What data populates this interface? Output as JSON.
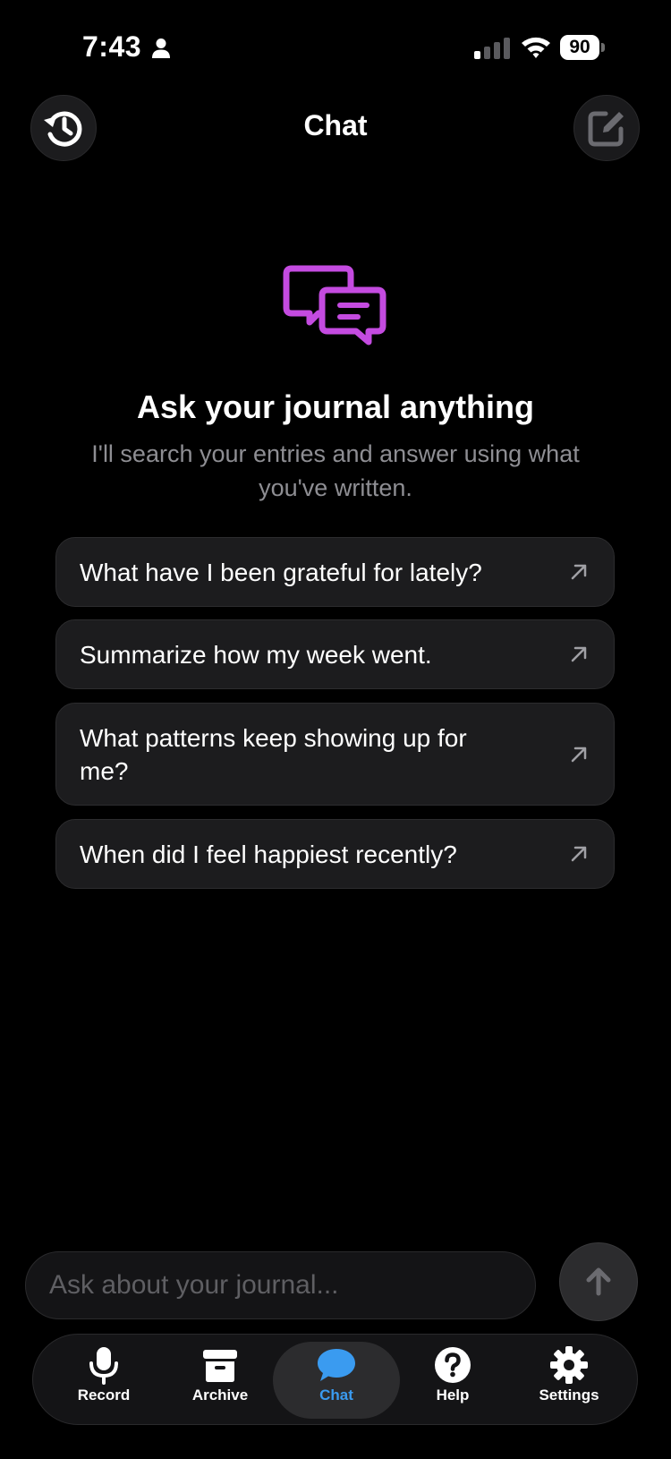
{
  "status_bar": {
    "time": "7:43",
    "battery": "90",
    "icons": [
      "person-icon",
      "cellular-signal-icon",
      "wifi-icon",
      "battery-icon"
    ]
  },
  "header": {
    "title": "Chat",
    "left_button_icon": "history-icon",
    "right_button_icon": "compose-icon"
  },
  "hero": {
    "icon": "chat-bubbles-icon",
    "title": "Ask your journal anything",
    "subtitle": "I'll search your entries and answer using what you've written."
  },
  "suggestions": [
    {
      "label": "What have I been grateful for lately?"
    },
    {
      "label": "Summarize how my week went."
    },
    {
      "label": "What patterns keep showing up for me?"
    },
    {
      "label": "When did I feel happiest recently?"
    }
  ],
  "input": {
    "placeholder": "Ask about your journal...",
    "value": ""
  },
  "tabs": [
    {
      "label": "Record",
      "icon": "microphone-icon",
      "active": false
    },
    {
      "label": "Archive",
      "icon": "archive-box-icon",
      "active": false
    },
    {
      "label": "Chat",
      "icon": "chat-bubble-icon",
      "active": true
    },
    {
      "label": "Help",
      "icon": "question-circle-icon",
      "active": false
    },
    {
      "label": "Settings",
      "icon": "gear-icon",
      "active": false
    }
  ],
  "colors": {
    "background": "#000000",
    "accent_purple": "#c44be0",
    "accent_blue": "#3a9bf0",
    "card": "#1c1c1e",
    "secondary_text": "#8e8e93"
  }
}
